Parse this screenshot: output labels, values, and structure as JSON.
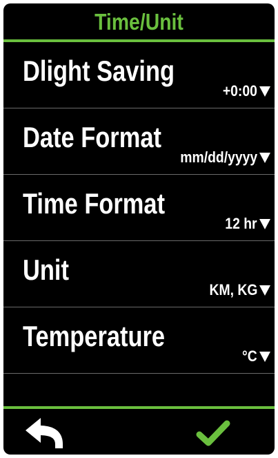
{
  "header": {
    "title": "Time/Unit"
  },
  "settings": [
    {
      "label": "Dlight Saving",
      "value": "+0:00"
    },
    {
      "label": "Date Format",
      "value": "mm/dd/yyyy"
    },
    {
      "label": "Time Format",
      "value": "12 hr"
    },
    {
      "label": "Unit",
      "value": "KM, KG"
    },
    {
      "label": "Temperature",
      "value": "°C"
    }
  ],
  "footer": {
    "back_icon": "back-arrow-icon",
    "confirm_icon": "checkmark-icon"
  },
  "colors": {
    "accent": "#6abf3e",
    "background": "#000000",
    "text": "#ffffff",
    "divider": "#6b6b6b"
  }
}
